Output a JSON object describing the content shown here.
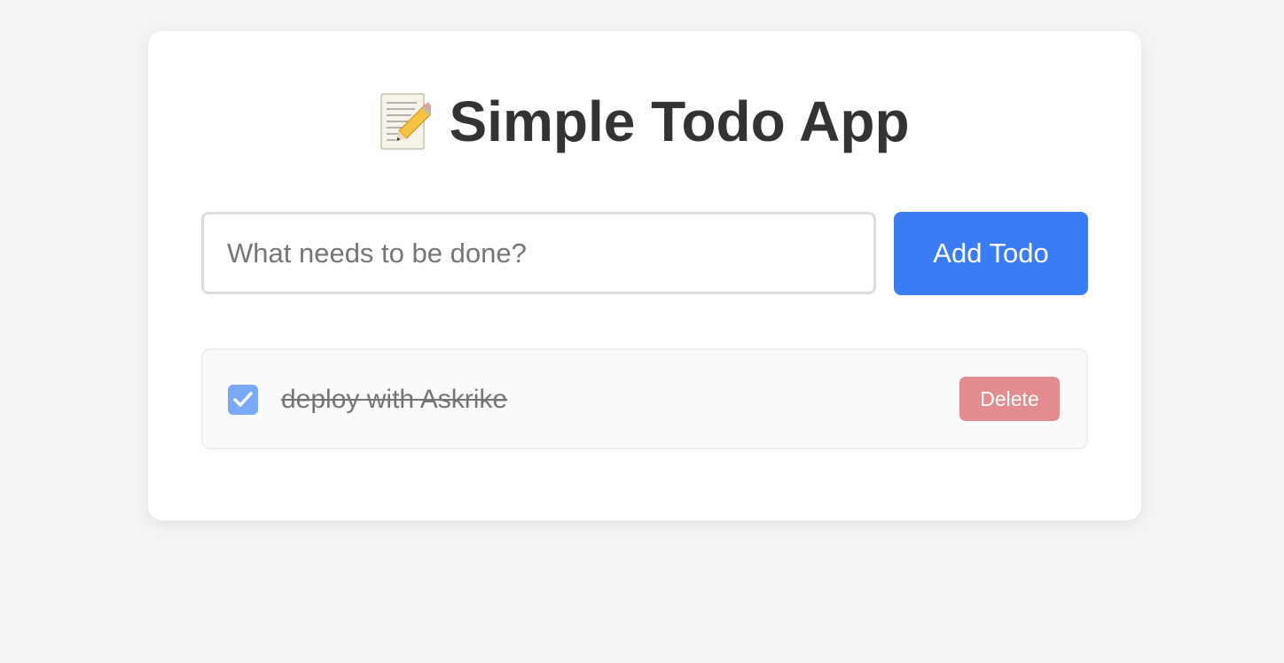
{
  "app": {
    "title": "Simple Todo App",
    "title_icon": "memo-pencil-icon"
  },
  "form": {
    "input_value": "",
    "input_placeholder": "What needs to be done?",
    "add_button_label": "Add Todo"
  },
  "todos": [
    {
      "text": "deploy with Askrike",
      "completed": true,
      "delete_label": "Delete"
    }
  ],
  "colors": {
    "accent": "#3a7cf4",
    "checkbox_checked": "#7aa9f7",
    "delete": "#e28c90",
    "page_background": "#f4f4f4",
    "card_background": "#ffffff",
    "title_text": "#333333"
  }
}
